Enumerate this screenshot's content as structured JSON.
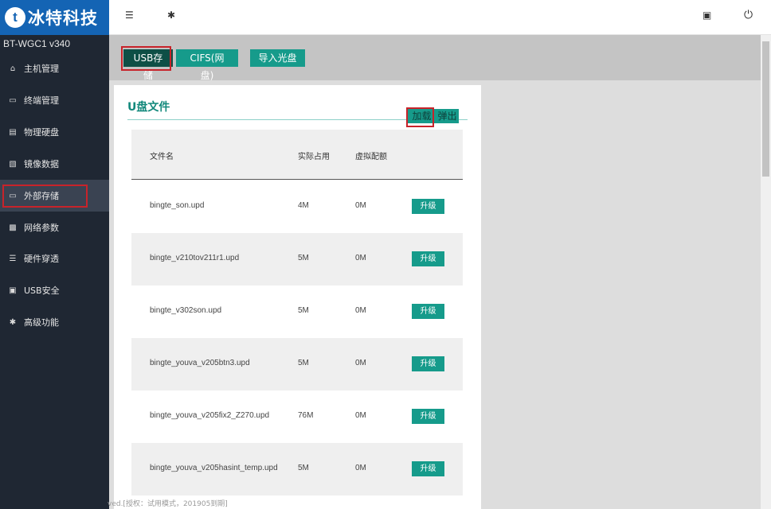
{
  "brand": {
    "logo_glyph": "t",
    "name": "冰特科技"
  },
  "version": "BT-WGC1  v340",
  "sidebar": {
    "items": [
      {
        "label": "主机管理",
        "icon": "home-icon"
      },
      {
        "label": "终端管理",
        "icon": "monitor-icon"
      },
      {
        "label": "物理硬盘",
        "icon": "hdd-icon"
      },
      {
        "label": "镜像数据",
        "icon": "database-icon"
      },
      {
        "label": "外部存储",
        "icon": "folder-icon"
      },
      {
        "label": "网络参数",
        "icon": "network-icon"
      },
      {
        "label": "硬件穿透",
        "icon": "list-icon"
      },
      {
        "label": "USB安全",
        "icon": "lock-icon"
      },
      {
        "label": "高级功能",
        "icon": "gear-icon"
      }
    ],
    "active_index": 4
  },
  "topbar": {
    "icons": [
      "list-icon",
      "gear-icon",
      "lock-icon",
      "power-icon"
    ]
  },
  "toolbar": {
    "usb_label": "USB存储",
    "cifs_label": "CIFS(网盘)",
    "import_label": "导入光盘"
  },
  "panel": {
    "title": "U盘文件",
    "load_label": "加载",
    "eject_label": "弹出",
    "headers": [
      "文件名",
      "实际占用",
      "虚拟配额"
    ],
    "upgrade_label": "升级",
    "rows": [
      {
        "name": "bingte_son.upd",
        "actual": "4M",
        "virtual": "0M"
      },
      {
        "name": "bingte_v210tov211r1.upd",
        "actual": "5M",
        "virtual": "0M"
      },
      {
        "name": "bingte_v302son.upd",
        "actual": "5M",
        "virtual": "0M"
      },
      {
        "name": "bingte_youva_v205btn3.upd",
        "actual": "5M",
        "virtual": "0M"
      },
      {
        "name": "bingte_youva_v205fix2_Z270.upd",
        "actual": "76M",
        "virtual": "0M"
      },
      {
        "name": "bingte_youva_v205hasint_temp.upd",
        "actual": "5M",
        "virtual": "0M"
      }
    ]
  },
  "footer": "ved.[授权：试用模式，201905到期]",
  "colors": {
    "teal": "#169b8b",
    "sidebar": "#1f2733",
    "brand": "#1464b4",
    "highlight": "#c8232a"
  }
}
